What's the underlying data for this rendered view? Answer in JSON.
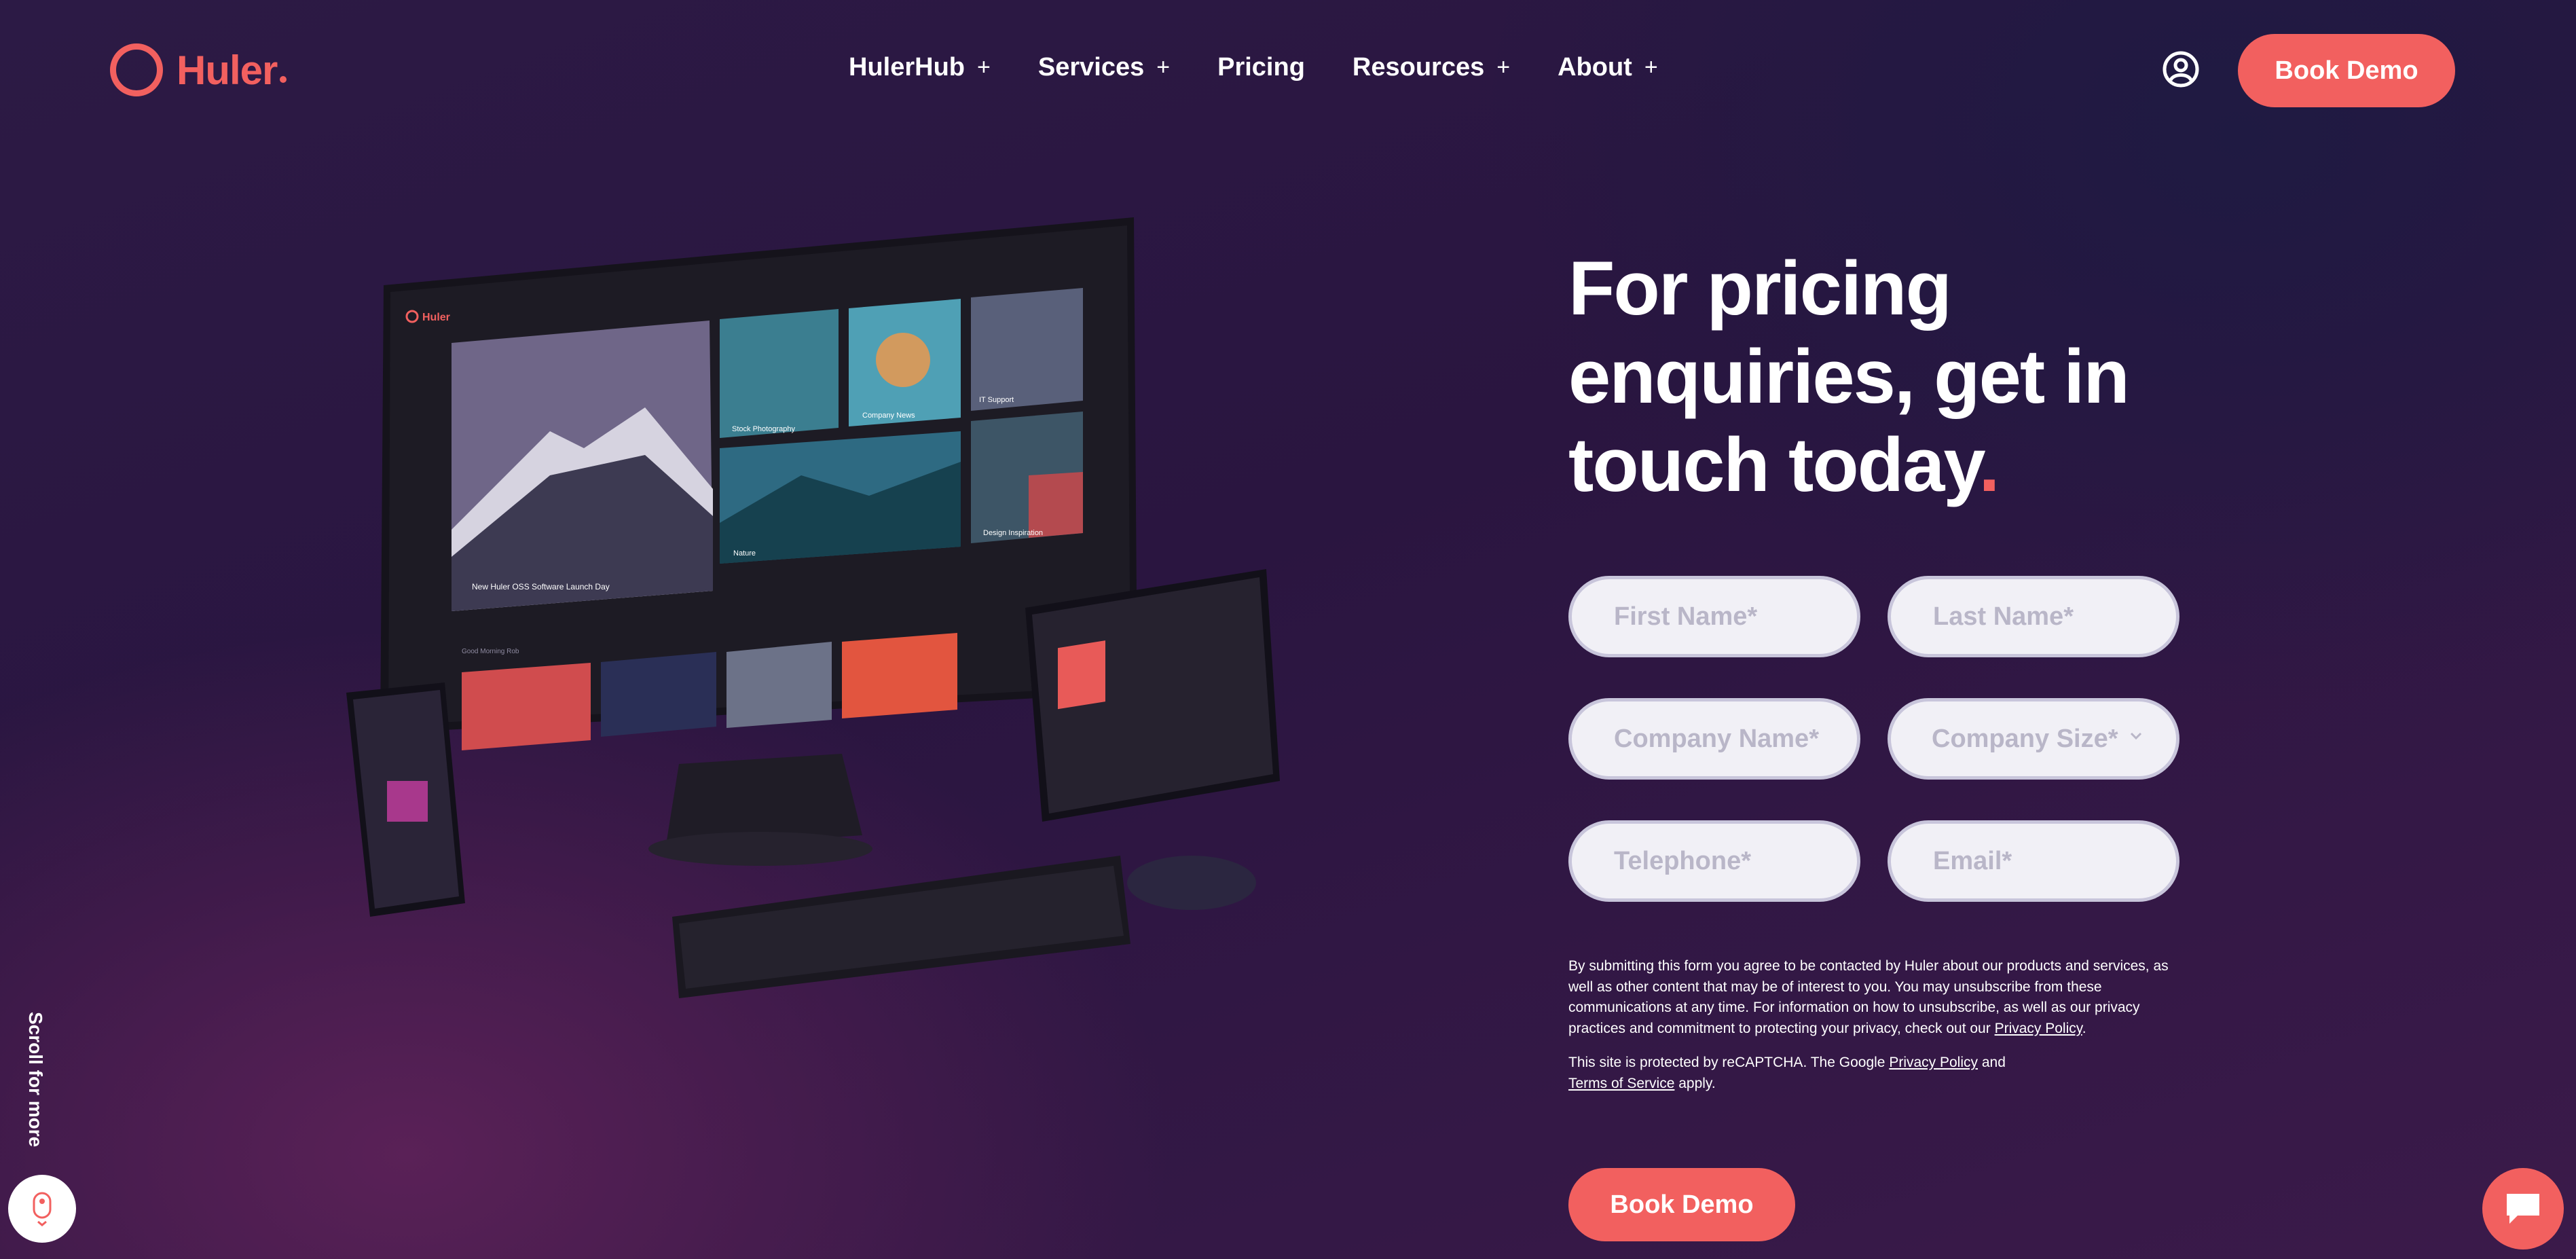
{
  "header": {
    "logo_text": "Huler",
    "nav": [
      {
        "label": "HulerHub",
        "has_plus": true
      },
      {
        "label": "Services",
        "has_plus": true
      },
      {
        "label": "Pricing",
        "has_plus": false
      },
      {
        "label": "Resources",
        "has_plus": true
      },
      {
        "label": "About",
        "has_plus": true
      }
    ],
    "plus_symbol": "+",
    "user_icon": "user-circle-icon",
    "book_demo": "Book Demo"
  },
  "hero": {
    "headline_line1": "For pricing",
    "headline_line2": "enquiries, get in",
    "headline_line3": "touch today",
    "headline_dot": "."
  },
  "form": {
    "first_name": "First Name*",
    "last_name": "Last Name*",
    "company_name": "Company Name*",
    "company_size": "Company Size*",
    "telephone": "Telephone*",
    "email": "Email*",
    "consent_text": "By submitting this form you agree to be contacted by Huler about our products and services, as well as other content that may be of interest to you. You may unsubscribe from these communications at any time. For information on how to unsubscribe, as well as our privacy practices and commitment to protecting your privacy, check out our ",
    "consent_link": "Privacy Policy",
    "consent_end": ".",
    "recaptcha_text": "This site is protected by reCAPTCHA. The Google ",
    "recaptcha_link1": "Privacy Policy",
    "recaptcha_and": " and ",
    "recaptcha_link2": "Terms of Service",
    "recaptcha_end": " apply.",
    "submit": "Book Demo"
  },
  "scroll": {
    "label": "Scroll for more",
    "icon": "mouse-scroll-icon"
  },
  "chat": {
    "icon": "chat-bubble-icon"
  },
  "devices": {
    "screen_logo": "Huler",
    "tile_labels": [
      "Stock Photography",
      "Company News",
      "IT Support",
      "Nature",
      "Design Inspiration",
      "New Huler OSS Software Launch Day",
      "Good Morning Rob"
    ]
  },
  "colors": {
    "accent": "#f2605f",
    "background": "#2a1540"
  }
}
